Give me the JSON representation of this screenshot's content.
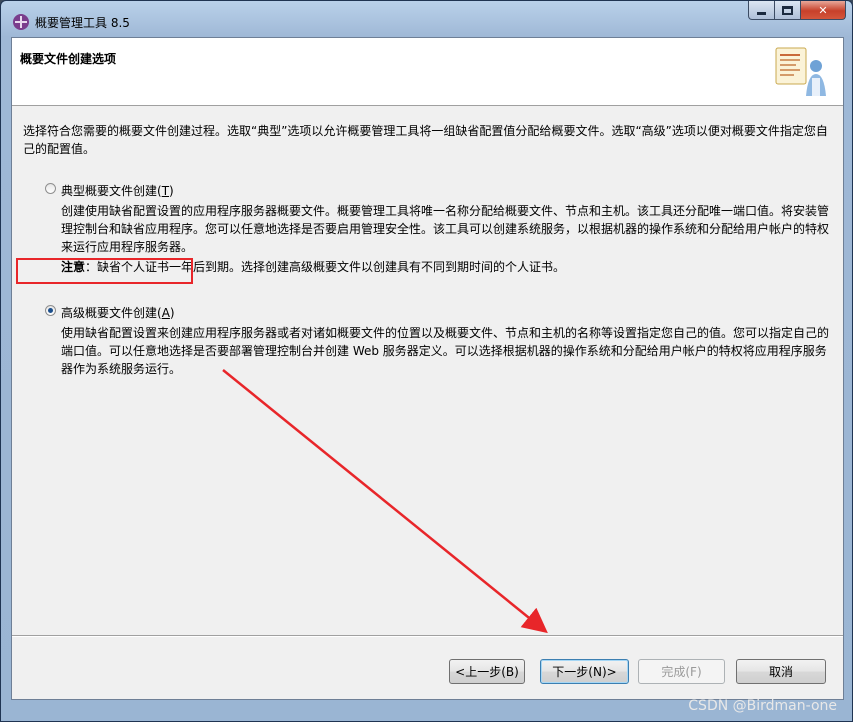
{
  "window": {
    "title": "概要管理工具 8.5",
    "icon": "app-logo-icon"
  },
  "header": {
    "title": "概要文件创建选项",
    "banner_icon": "wizard-person-icon"
  },
  "description": "选择符合您需要的概要文件创建过程。选取“典型”选项以允许概要管理工具将一组缺省配置值分配给概要文件。选取“高级”选项以便对概要文件指定您自己的配置值。",
  "options": {
    "typical": {
      "label": "典型概要文件创建(",
      "mnemonic": "T",
      "label_end": ")",
      "checked": false,
      "desc": "创建使用缺省配置设置的应用程序服务器概要文件。概要管理工具将唯一名称分配给概要文件、节点和主机。该工具还分配唯一端口值。将安装管理控制台和缺省应用程序。您可以任意地选择是否要启用管理安全性。该工具可以创建系统服务，以根据机器的操作系统和分配给用户帐户的特权来运行应用程序服务器。",
      "note_label": "注意",
      "note_text": "：缺省个人证书一年后到期。选择创建高级概要文件以创建具有不同到期时间的个人证书。"
    },
    "advanced": {
      "label": "高级概要文件创建(",
      "mnemonic": "A",
      "label_end": ")",
      "checked": true,
      "desc": "使用缺省配置设置来创建应用程序服务器或者对诸如概要文件的位置以及概要文件、节点和主机的名称等设置指定您自己的值。您可以指定自己的端口值。可以任意地选择是否要部署管理控制台并创建 Web 服务器定义。可以选择根据机器的操作系统和分配给用户帐户的特权将应用程序服务器作为系统服务运行。"
    }
  },
  "buttons": {
    "back": "<上一步(B)",
    "next": "下一步(N)>",
    "finish": "完成(F)",
    "cancel": "取消"
  },
  "annotations": {
    "highlight_color": "#e8262a",
    "arrow_color": "#e8262a"
  },
  "watermark": "CSDN @Birdman-one"
}
